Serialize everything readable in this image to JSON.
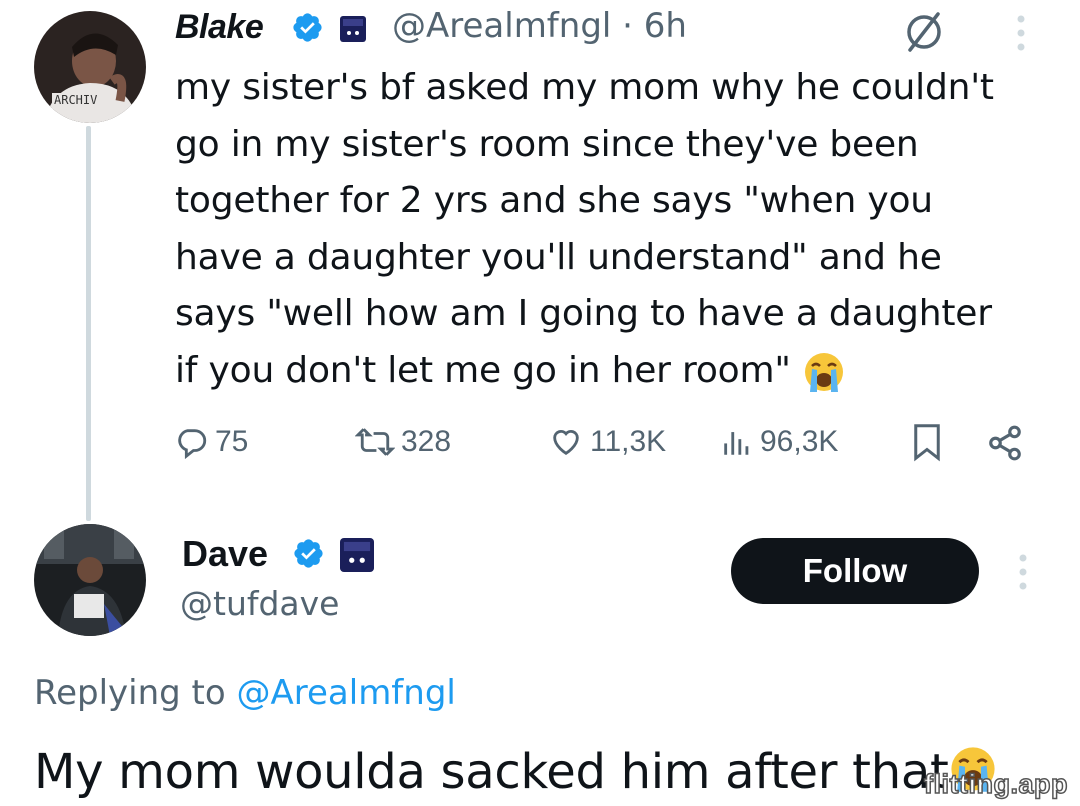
{
  "tweet": {
    "author": {
      "name": "Blake",
      "handle": "@Arealmfngl",
      "time": "6h",
      "separator": " · ",
      "avatar_text": "ARCHIV"
    },
    "text": "my sister's bf asked my mom why he couldn't\ngo in my sister's room since they've been\ntogether for 2 yrs and she says \"when you\nhave a daughter you'll understand\" and he\nsays \"well how am I going to have a daughter\nif you don't let me go in her room\"",
    "trailing_emoji": "loudly-crying-face",
    "stats": {
      "replies": "75",
      "retweets": "328",
      "likes": "11,3K",
      "views": "96,3K"
    }
  },
  "reply": {
    "author": {
      "name": "Dave",
      "handle": "@tufdave"
    },
    "follow_label": "Follow",
    "replying_prefix": "Replying to ",
    "replying_handle": "@Arealmfngl",
    "text": "My mom woulda sacked him after that",
    "trailing_emoji": "loudly-crying-face"
  },
  "watermark": "flitting.app",
  "colors": {
    "verified": "#1d9bf0",
    "muted": "#536471",
    "text": "#0f1419",
    "link": "#1d9bf0",
    "follow_bg": "#0f1419",
    "badge": "#1a1f5a"
  }
}
